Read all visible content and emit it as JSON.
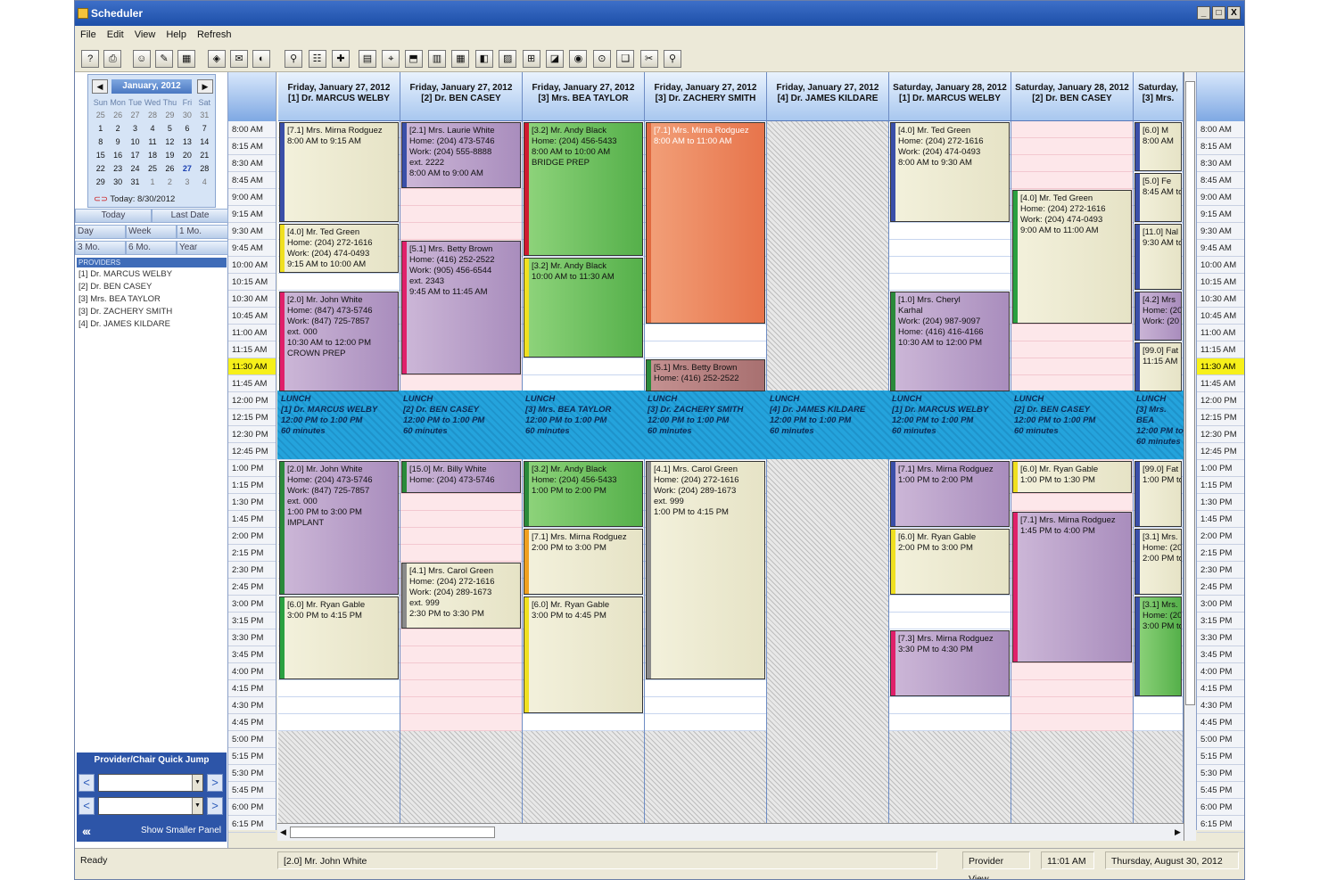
{
  "window": {
    "title": "Scheduler",
    "controls": [
      "_",
      "□",
      "X"
    ]
  },
  "menu": [
    "File",
    "Edit",
    "View",
    "Help",
    "Refresh"
  ],
  "mini_calendar": {
    "month_label": "January, 2012",
    "dow": [
      "Sun",
      "Mon",
      "Tue",
      "Wed",
      "Thu",
      "Fri",
      "Sat"
    ],
    "weeks": [
      [
        "25",
        "26",
        "27",
        "28",
        "29",
        "30",
        "31"
      ],
      [
        "1",
        "2",
        "3",
        "4",
        "5",
        "6",
        "7"
      ],
      [
        "8",
        "9",
        "10",
        "11",
        "12",
        "13",
        "14"
      ],
      [
        "15",
        "16",
        "17",
        "18",
        "19",
        "20",
        "21"
      ],
      [
        "22",
        "23",
        "24",
        "25",
        "26",
        "27",
        "28"
      ],
      [
        "29",
        "30",
        "31",
        "1",
        "2",
        "3",
        "4"
      ]
    ],
    "today_text": "Today: 8/30/2012"
  },
  "calendar_buttons": {
    "today": "Today",
    "last_date": "Last Date",
    "day": "Day",
    "week": "Week",
    "one_mo": "1 Mo.",
    "three_mo": "3 Mo.",
    "six_mo": "6 Mo.",
    "year": "Year"
  },
  "providers_header": "PROVIDERS",
  "providers": [
    "[1] Dr. MARCUS WELBY",
    "[2] Dr. BEN CASEY",
    "[3] Mrs. BEA TAYLOR",
    "[3] Dr. ZACHERY SMITH",
    "[4] Dr. JAMES KILDARE"
  ],
  "quick_jump": {
    "title": "Provider/Chair Quick Jump",
    "show_panel": "Show Smaller Panel"
  },
  "times": [
    "8:00 AM",
    "8:15 AM",
    "8:30 AM",
    "8:45 AM",
    "9:00 AM",
    "9:15 AM",
    "9:30 AM",
    "9:45 AM",
    "10:00 AM",
    "10:15 AM",
    "10:30 AM",
    "10:45 AM",
    "11:00 AM",
    "11:15 AM",
    "11:30 AM",
    "11:45 AM",
    "12:00 PM",
    "12:15 PM",
    "12:30 PM",
    "12:45 PM",
    "1:00 PM",
    "1:15 PM",
    "1:30 PM",
    "1:45 PM",
    "2:00 PM",
    "2:15 PM",
    "2:30 PM",
    "2:45 PM",
    "3:00 PM",
    "3:15 PM",
    "3:30 PM",
    "3:45 PM",
    "4:00 PM",
    "4:15 PM",
    "4:30 PM",
    "4:45 PM",
    "5:00 PM",
    "5:15 PM",
    "5:30 PM",
    "5:45 PM",
    "6:00 PM",
    "6:15 PM"
  ],
  "current_time_label": "11:30 AM",
  "columns": [
    {
      "date": "Friday, January 27, 2012",
      "provider": "[1] Dr. MARCUS WELBY"
    },
    {
      "date": "Friday, January 27, 2012",
      "provider": "[2] Dr. BEN CASEY"
    },
    {
      "date": "Friday, January 27, 2012",
      "provider": "[3] Mrs. BEA TAYLOR"
    },
    {
      "date": "Friday, January 27, 2012",
      "provider": "[3] Dr. ZACHERY SMITH"
    },
    {
      "date": "Friday, January 27, 2012",
      "provider": "[4] Dr. JAMES KILDARE"
    },
    {
      "date": "Saturday, January 28, 2012",
      "provider": "[1] Dr. MARCUS WELBY"
    },
    {
      "date": "Saturday, January 28, 2012",
      "provider": "[2] Dr. BEN CASEY"
    },
    {
      "date": "Saturday,",
      "provider": "[3] Mrs."
    }
  ],
  "lunch": [
    {
      "label": "LUNCH",
      "provider": "[1] Dr. MARCUS WELBY",
      "time": "12:00 PM to 1:00 PM",
      "dur": "60 minutes"
    },
    {
      "label": "LUNCH",
      "provider": "[2] Dr. BEN CASEY",
      "time": "12:00 PM to 1:00 PM",
      "dur": "60 minutes"
    },
    {
      "label": "LUNCH",
      "provider": "[3] Mrs. BEA TAYLOR",
      "time": "12:00 PM to 1:00 PM",
      "dur": "60 minutes"
    },
    {
      "label": "LUNCH",
      "provider": "[3] Dr. ZACHERY SMITH",
      "time": "12:00 PM to 1:00 PM",
      "dur": "60 minutes"
    },
    {
      "label": "LUNCH",
      "provider": "[4] Dr. JAMES KILDARE",
      "time": "12:00 PM to 1:00 PM",
      "dur": "60 minutes"
    },
    {
      "label": "LUNCH",
      "provider": "[1] Dr. MARCUS WELBY",
      "time": "12:00 PM to 1:00 PM",
      "dur": "60 minutes"
    },
    {
      "label": "LUNCH",
      "provider": "[2] Dr. BEN CASEY",
      "time": "12:00 PM to 1:00 PM",
      "dur": "60 minutes"
    },
    {
      "label": "LUNCH",
      "provider": "[3] Mrs. BEA",
      "time": "12:00 PM to",
      "dur": "60 minutes"
    }
  ],
  "appointments": [
    {
      "col": 0,
      "start": 0,
      "end": 6,
      "color": "cream",
      "bar": "#3a4fa8",
      "lines": [
        "[7.1] Mrs. Mirna Rodguez",
        "8:00 AM to 9:15 AM"
      ]
    },
    {
      "col": 0,
      "start": 6,
      "end": 9,
      "color": "cream",
      "bar": "#f0e020",
      "lines": [
        "[4.0] Mr. Ted Green",
        "Home: (204) 272-1616",
        "Work: (204) 474-0493",
        "9:15 AM to 10:00 AM"
      ]
    },
    {
      "col": 0,
      "start": 10,
      "end": 16,
      "color": "purple",
      "bar": "#e0206a",
      "lines": [
        "[2.0] Mr. John White",
        "Home: (847) 473-5746",
        "Work: (847) 725-7857",
        "ext. 000",
        "10:30 AM to 12:00 PM",
        "CROWN PREP"
      ]
    },
    {
      "col": 0,
      "start": 20,
      "end": 28,
      "color": "purple",
      "bar": "#2a8a3a",
      "lines": [
        "[2.0] Mr. John White",
        "Home: (204) 473-5746",
        "Work: (847) 725-7857",
        "ext. 000",
        "1:00 PM to 3:00 PM",
        "IMPLANT"
      ]
    },
    {
      "col": 0,
      "start": 28,
      "end": 33,
      "color": "cream",
      "bar": "#2aa040",
      "lines": [
        "[6.0] Mr. Ryan Gable",
        "3:00 PM to 4:15 PM"
      ]
    },
    {
      "col": 1,
      "start": 0,
      "end": 4,
      "color": "purple",
      "bar": "#3a4fa8",
      "lines": [
        "[2.1] Mrs. Laurie White",
        "Home: (204) 473-5746",
        "Work: (204) 555-8888",
        "ext. 2222",
        "8:00 AM to 9:00 AM"
      ]
    },
    {
      "col": 1,
      "start": 7,
      "end": 15,
      "color": "purple",
      "bar": "#e0206a",
      "lines": [
        "[5.1] Mrs. Betty Brown",
        "Home: (416) 252-2522",
        "Work: (905) 456-6544",
        "ext. 2343",
        "9:45 AM to 11:45 AM"
      ]
    },
    {
      "col": 1,
      "start": 20,
      "end": 22,
      "color": "purple",
      "bar": "#2a8a3a",
      "lines": [
        "[15.0] Mr. Billy White",
        "Home: (204) 473-5746"
      ]
    },
    {
      "col": 1,
      "start": 26,
      "end": 30,
      "color": "cream",
      "bar": "#8a8a8a",
      "lines": [
        "[4.1] Mrs. Carol Green",
        "Home: (204) 272-1616",
        "Work: (204) 289-1673",
        "ext. 999",
        "2:30 PM to 3:30 PM"
      ]
    },
    {
      "col": 2,
      "start": 0,
      "end": 8,
      "color": "green",
      "bar": "#d01a30",
      "lines": [
        "[3.2] Mr. Andy Black",
        "Home: (204) 456-5433",
        "8:00 AM to 10:00 AM",
        "BRIDGE PREP"
      ]
    },
    {
      "col": 2,
      "start": 8,
      "end": 14,
      "color": "green",
      "bar": "#f0e020",
      "lines": [
        "[3.2] Mr. Andy Black",
        "10:00 AM to 11:30 AM"
      ]
    },
    {
      "col": 2,
      "start": 20,
      "end": 24,
      "color": "green",
      "bar": "#2a8a3a",
      "lines": [
        "[3.2] Mr. Andy Black",
        "Home: (204) 456-5433",
        "1:00 PM to 2:00 PM"
      ]
    },
    {
      "col": 2,
      "start": 24,
      "end": 28,
      "color": "cream",
      "bar": "#f0a020",
      "lines": [
        "[7.1] Mrs. Mirna Rodguez",
        "2:00 PM to 3:00 PM"
      ]
    },
    {
      "col": 2,
      "start": 28,
      "end": 35,
      "color": "cream",
      "bar": "#f0e020",
      "lines": [
        "[6.0] Mr. Ryan Gable",
        "3:00 PM to 4:45 PM"
      ]
    },
    {
      "col": 3,
      "start": 0,
      "end": 12,
      "color": "orange",
      "bar": "#e06a40",
      "lines": [
        "[7.1] Mrs. Mirna Rodguez",
        "8:00 AM to 11:00 AM"
      ]
    },
    {
      "col": 3,
      "start": 14,
      "end": 16,
      "color": "rose",
      "bar": "#2a8a3a",
      "lines": [
        "[5.1] Mrs. Betty Brown",
        "Home: (416) 252-2522"
      ]
    },
    {
      "col": 3,
      "start": 20,
      "end": 33,
      "color": "cream",
      "bar": "#8a8a8a",
      "lines": [
        "[4.1] Mrs. Carol Green",
        "Home: (204) 272-1616",
        "Work: (204) 289-1673",
        "ext. 999",
        "1:00 PM to 4:15 PM"
      ]
    },
    {
      "col": 5,
      "start": 0,
      "end": 6,
      "color": "cream",
      "bar": "#3a4fa8",
      "lines": [
        "[4.0] Mr. Ted Green",
        "Home: (204) 272-1616",
        "Work: (204) 474-0493",
        "8:00 AM to 9:30 AM"
      ]
    },
    {
      "col": 5,
      "start": 10,
      "end": 16,
      "color": "purple",
      "bar": "#2a8a3a",
      "lines": [
        "[1.0] Mrs. Cheryl",
        "Karhal",
        "Work: (204) 987-9097",
        "Home: (416) 416-4166",
        "10:30 AM to 12:00 PM"
      ]
    },
    {
      "col": 5,
      "start": 20,
      "end": 24,
      "color": "purple",
      "bar": "#3a4fa8",
      "lines": [
        "[7.1] Mrs. Mirna Rodguez",
        "1:00 PM to 2:00 PM"
      ]
    },
    {
      "col": 5,
      "start": 24,
      "end": 28,
      "color": "cream",
      "bar": "#f0e020",
      "lines": [
        "[6.0] Mr. Ryan Gable",
        "2:00 PM to 3:00 PM"
      ]
    },
    {
      "col": 5,
      "start": 30,
      "end": 34,
      "color": "purple",
      "bar": "#e0206a",
      "lines": [
        "[7.3] Mrs. Mirna Rodguez",
        "3:30 PM to 4:30 PM"
      ]
    },
    {
      "col": 6,
      "start": 4,
      "end": 12,
      "color": "cream",
      "bar": "#2aa040",
      "lines": [
        "[4.0] Mr. Ted Green",
        "Home: (204) 272-1616",
        "Work: (204) 474-0493",
        "9:00 AM to 11:00 AM"
      ]
    },
    {
      "col": 6,
      "start": 20,
      "end": 22,
      "color": "cream",
      "bar": "#f0e020",
      "lines": [
        "[6.0] Mr. Ryan Gable",
        "1:00 PM to 1:30 PM"
      ]
    },
    {
      "col": 6,
      "start": 23,
      "end": 32,
      "color": "purple",
      "bar": "#e0206a",
      "lines": [
        "[7.1] Mrs. Mirna Rodguez",
        "1:45 PM to 4:00 PM"
      ]
    },
    {
      "col": 7,
      "start": 0,
      "end": 3,
      "color": "cream",
      "bar": "#3a4fa8",
      "lines": [
        "[6.0] M",
        "8:00 AM"
      ]
    },
    {
      "col": 7,
      "start": 3,
      "end": 6,
      "color": "cream",
      "bar": "#3a4fa8",
      "lines": [
        "[5.0] Fe",
        "8:45 AM to"
      ]
    },
    {
      "col": 7,
      "start": 6,
      "end": 10,
      "color": "cream",
      "bar": "#3a4fa8",
      "lines": [
        "[11.0] Nal",
        "9:30 AM to"
      ]
    },
    {
      "col": 7,
      "start": 10,
      "end": 13,
      "color": "purple",
      "bar": "#3a4fa8",
      "lines": [
        "[4.2] Mrs",
        "Home: (20",
        "Work: (20"
      ]
    },
    {
      "col": 7,
      "start": 13,
      "end": 16,
      "color": "cream",
      "bar": "#3a4fa8",
      "lines": [
        "[99.0] Fat",
        "11:15 AM"
      ]
    },
    {
      "col": 7,
      "start": 20,
      "end": 24,
      "color": "cream",
      "bar": "#3a4fa8",
      "lines": [
        "[99.0] Fat",
        "1:00 PM to"
      ]
    },
    {
      "col": 7,
      "start": 24,
      "end": 28,
      "color": "cream",
      "bar": "#3a4fa8",
      "lines": [
        "[3.1] Mrs.",
        "Home: (20",
        "2:00 PM to"
      ]
    },
    {
      "col": 7,
      "start": 28,
      "end": 34,
      "color": "green",
      "bar": "#3a4fa8",
      "lines": [
        "[3.1] Mrs.",
        "Home: (20",
        "3:00 PM to"
      ]
    }
  ],
  "status": {
    "ready": "Ready",
    "selected": "[2.0] Mr. John White",
    "view": "Provider View",
    "time": "11:01 AM",
    "date": "Thursday, August 30, 2012"
  }
}
